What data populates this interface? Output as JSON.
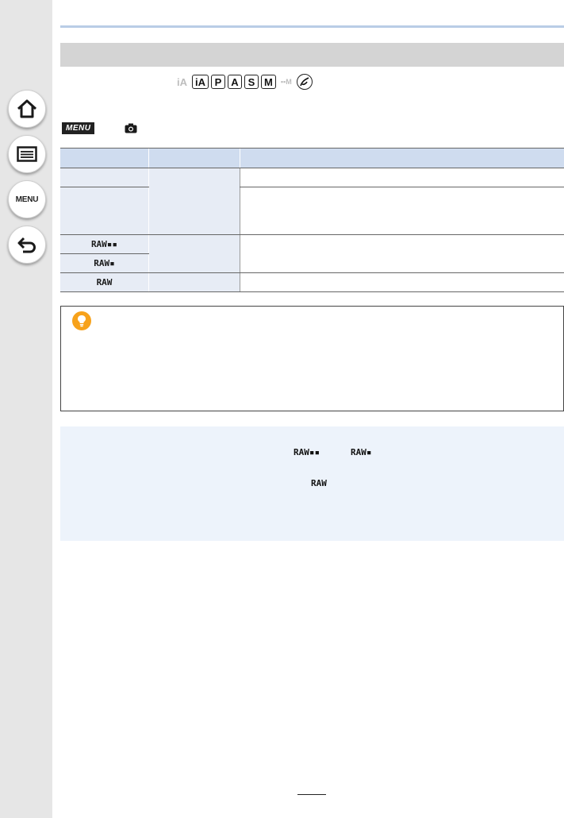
{
  "sidebar": {
    "items": [
      {
        "icon": "home-icon"
      },
      {
        "icon": "contents-list-icon"
      },
      {
        "icon": "menu-icon",
        "label": "MENU"
      },
      {
        "icon": "back-arrow-icon"
      }
    ]
  },
  "modes": [
    "iA",
    "iA+",
    "P",
    "A",
    "S",
    "M",
    "movie-M",
    "creative"
  ],
  "menu_path": {
    "badge": "MENU",
    "icon": "camera-icon"
  },
  "table": {
    "rows": [
      {
        "setting": ""
      },
      {
        "setting": ""
      },
      {
        "setting": "RAW▪▪"
      },
      {
        "setting": "RAW▪"
      },
      {
        "setting": "RAW"
      }
    ]
  },
  "notes": {
    "raw_fine": "RAW▪▪",
    "raw_std": "RAW▪",
    "raw_only": "RAW"
  },
  "colors": {
    "section_bar": "#d4d4d4",
    "table_header": "#cfdcef",
    "tip_icon": "#f7a21b",
    "note_bg": "#edf3fb"
  }
}
